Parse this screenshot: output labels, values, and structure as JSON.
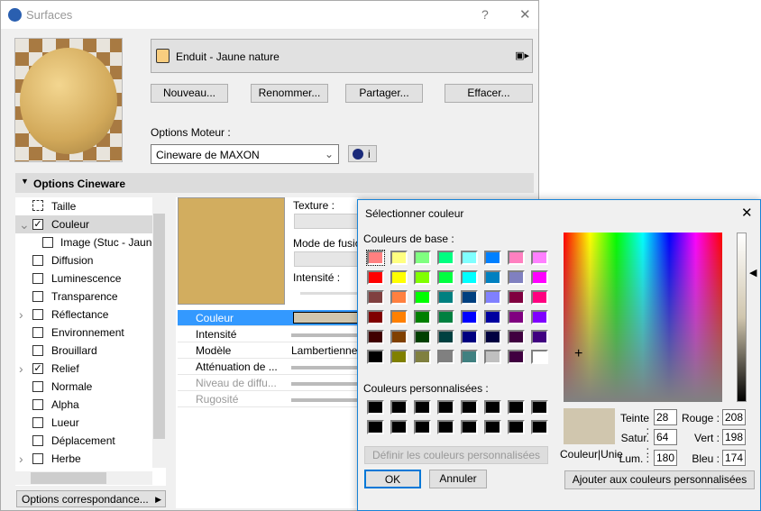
{
  "window": {
    "title": "Surfaces",
    "help": "?",
    "close": "✕"
  },
  "surface": {
    "name": "Enduit - Jaune nature",
    "swatch": "#f8cd7f"
  },
  "buttons": {
    "new": "Nouveau...",
    "rename": "Renommer...",
    "share": "Partager...",
    "delete": "Effacer..."
  },
  "engine": {
    "label": "Options Moteur :",
    "value": "Cineware de MAXON",
    "info": "i"
  },
  "section": {
    "title": "Options Cineware"
  },
  "tree": [
    {
      "label": "Taille",
      "check": null,
      "expand": ""
    },
    {
      "label": "Couleur",
      "check": true,
      "expand": "v",
      "selected": true
    },
    {
      "label": "Image (Stuc - Jaune",
      "check": null,
      "expand": "",
      "image": true
    },
    {
      "label": "Diffusion",
      "check": false,
      "expand": ""
    },
    {
      "label": "Luminescence",
      "check": false,
      "expand": ""
    },
    {
      "label": "Transparence",
      "check": false,
      "expand": ""
    },
    {
      "label": "Réflectance",
      "check": false,
      "expand": ">"
    },
    {
      "label": "Environnement",
      "check": false,
      "expand": ""
    },
    {
      "label": "Brouillard",
      "check": false,
      "expand": ""
    },
    {
      "label": "Relief",
      "check": true,
      "expand": ">"
    },
    {
      "label": "Normale",
      "check": false,
      "expand": ""
    },
    {
      "label": "Alpha",
      "check": false,
      "expand": ""
    },
    {
      "label": "Lueur",
      "check": false,
      "expand": ""
    },
    {
      "label": "Déplacement",
      "check": false,
      "expand": ""
    },
    {
      "label": "Herbe",
      "check": false,
      "expand": ">"
    }
  ],
  "mapping_button": "Options correspondance...",
  "texture": {
    "label": "Texture :",
    "blend_label": "Mode de fusio",
    "intensity_label": "Intensité :"
  },
  "props": [
    {
      "label": "Couleur",
      "value": "",
      "selected": true
    },
    {
      "label": "Intensité",
      "value": ""
    },
    {
      "label": "Modèle",
      "value": "Lambertienne"
    },
    {
      "label": "Atténuation de ...",
      "value": ""
    },
    {
      "label": "Niveau de diffu...",
      "value": "",
      "disabled": true
    },
    {
      "label": "Rugosité",
      "value": "",
      "disabled": true
    }
  ],
  "color_dialog": {
    "title": "Sélectionner couleur",
    "close": "✕",
    "basic_label": "Couleurs de base :",
    "basic_colors": [
      "#FF8080",
      "#FFFF80",
      "#80FF80",
      "#00FF80",
      "#80FFFF",
      "#0080FF",
      "#FF80C0",
      "#FF80FF",
      "#FF0000",
      "#FFFF00",
      "#80FF00",
      "#00FF40",
      "#00FFFF",
      "#0080C0",
      "#8080C0",
      "#FF00FF",
      "#804040",
      "#FF8040",
      "#00FF00",
      "#008080",
      "#004080",
      "#8080FF",
      "#800040",
      "#FF0080",
      "#800000",
      "#FF8000",
      "#008000",
      "#008040",
      "#0000FF",
      "#0000A0",
      "#800080",
      "#8000FF",
      "#400000",
      "#804000",
      "#004000",
      "#004040",
      "#000080",
      "#000040",
      "#400040",
      "#400080",
      "#000000",
      "#808000",
      "#808040",
      "#808080",
      "#408080",
      "#C0C0C0",
      "#400040",
      "#FFFFFF"
    ],
    "custom_label": "Couleurs personnalisées :",
    "custom_colors": [
      "#000000",
      "#000000",
      "#000000",
      "#000000",
      "#000000",
      "#000000",
      "#000000",
      "#000000",
      "#000000",
      "#000000",
      "#000000",
      "#000000",
      "#000000",
      "#000000",
      "#000000",
      "#000000"
    ],
    "define_custom": "Définir les couleurs personnalisées >>",
    "ok": "OK",
    "cancel": "Annuler",
    "preview_label": "Couleur|Unie",
    "current": "#D0C6AE",
    "hue_label": "Teinte :",
    "hue": "28",
    "sat_label": "Satur. :",
    "sat": "64",
    "lum_label": "Lum. :",
    "lum": "180",
    "red_label": "Rouge :",
    "red": "208",
    "green_label": "Vert :",
    "green": "198",
    "blue_label": "Bleu :",
    "blue": "174",
    "add_custom": "Ajouter aux couleurs personnalisées"
  }
}
